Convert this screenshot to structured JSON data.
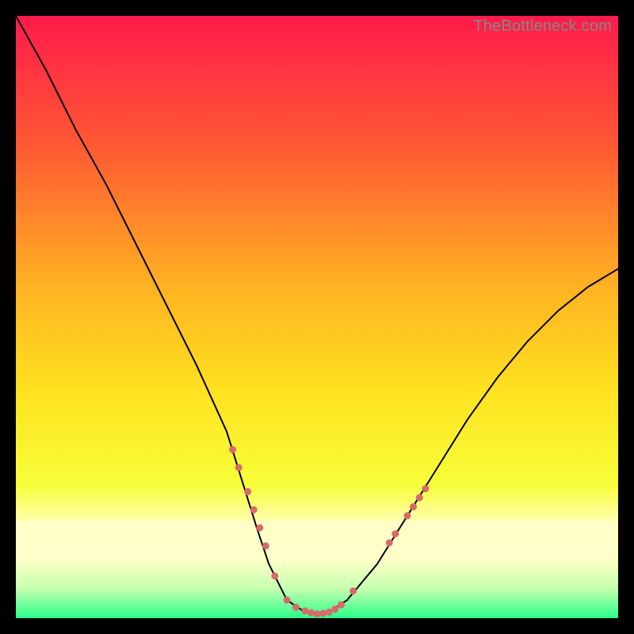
{
  "watermark": "TheBottleneck.com",
  "chart_data": {
    "type": "line",
    "title": "",
    "xlabel": "",
    "ylabel": "",
    "xlim": [
      0,
      100
    ],
    "ylim": [
      0,
      100
    ],
    "grid": false,
    "legend": false,
    "background_gradient": {
      "top": "#ff1a4b",
      "mid_upper": "#ff7a2a",
      "mid": "#ffd21f",
      "mid_lower": "#f2ff3a",
      "low_band": "#ffffb0",
      "bottom": "#2bff8a"
    },
    "series": [
      {
        "name": "bottleneck-curve",
        "x": [
          0,
          5,
          10,
          15,
          20,
          25,
          30,
          35,
          40,
          42,
          45,
          48,
          50,
          52,
          55,
          60,
          65,
          70,
          75,
          80,
          85,
          90,
          95,
          100
        ],
        "y": [
          100,
          91,
          81,
          72,
          62,
          52,
          42,
          31,
          15,
          9,
          3,
          1,
          0.5,
          1,
          3,
          9,
          17,
          25,
          33,
          40,
          46,
          51,
          55,
          58
        ],
        "stroke": "#000000",
        "stroke_width": 2
      }
    ],
    "markers": {
      "name": "highlight-dots",
      "color": "#d86a6a",
      "radius": 4.5,
      "points": [
        {
          "x": 36,
          "y": 28
        },
        {
          "x": 37,
          "y": 25
        },
        {
          "x": 38.5,
          "y": 21
        },
        {
          "x": 39.5,
          "y": 18
        },
        {
          "x": 40.5,
          "y": 15
        },
        {
          "x": 41.5,
          "y": 12
        },
        {
          "x": 43,
          "y": 7
        },
        {
          "x": 45,
          "y": 3
        },
        {
          "x": 46.5,
          "y": 1.8
        },
        {
          "x": 48,
          "y": 1.2
        },
        {
          "x": 49,
          "y": 0.9
        },
        {
          "x": 50,
          "y": 0.7
        },
        {
          "x": 51,
          "y": 0.8
        },
        {
          "x": 52,
          "y": 1.0
        },
        {
          "x": 53,
          "y": 1.5
        },
        {
          "x": 54,
          "y": 2.2
        },
        {
          "x": 56,
          "y": 4.5
        },
        {
          "x": 62,
          "y": 12.5
        },
        {
          "x": 63,
          "y": 14
        },
        {
          "x": 65,
          "y": 17
        },
        {
          "x": 66,
          "y": 18.5
        },
        {
          "x": 67,
          "y": 20
        },
        {
          "x": 68,
          "y": 21.5
        }
      ]
    }
  }
}
